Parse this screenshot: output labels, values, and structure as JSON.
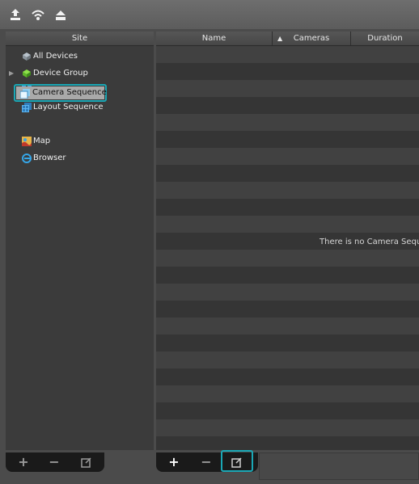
{
  "toolbar": {
    "icons": [
      "upload-icon",
      "wireless-icon",
      "eject-icon"
    ]
  },
  "sidebar": {
    "header": "Site",
    "items": [
      {
        "label": "All Devices",
        "icon": "all-devices-icon"
      },
      {
        "label": "Device Group",
        "icon": "device-group-icon",
        "expandable": true
      },
      {
        "label": "Layout",
        "icon": "layout-icon"
      },
      {
        "label": "Layout Sequence",
        "icon": "layout-sequence-icon"
      },
      {
        "label": "Camera Sequence",
        "icon": "camera-sequence-icon",
        "selected": true
      },
      {
        "label": "Map",
        "icon": "map-icon"
      },
      {
        "label": "Browser",
        "icon": "browser-icon"
      }
    ],
    "buttons": {
      "add": "+",
      "remove": "−",
      "edit": "edit-icon"
    }
  },
  "list": {
    "columns": [
      "Name",
      "Cameras",
      "Duration"
    ],
    "sort_indicator": "▲",
    "empty_message": "There is no Camera Sequen",
    "buttons": {
      "add": "+",
      "remove": "−",
      "edit": "edit-icon"
    }
  },
  "colors": {
    "accent": "#1aa7b5",
    "background": "#4b4b4b",
    "panel": "#3b3b3b"
  }
}
